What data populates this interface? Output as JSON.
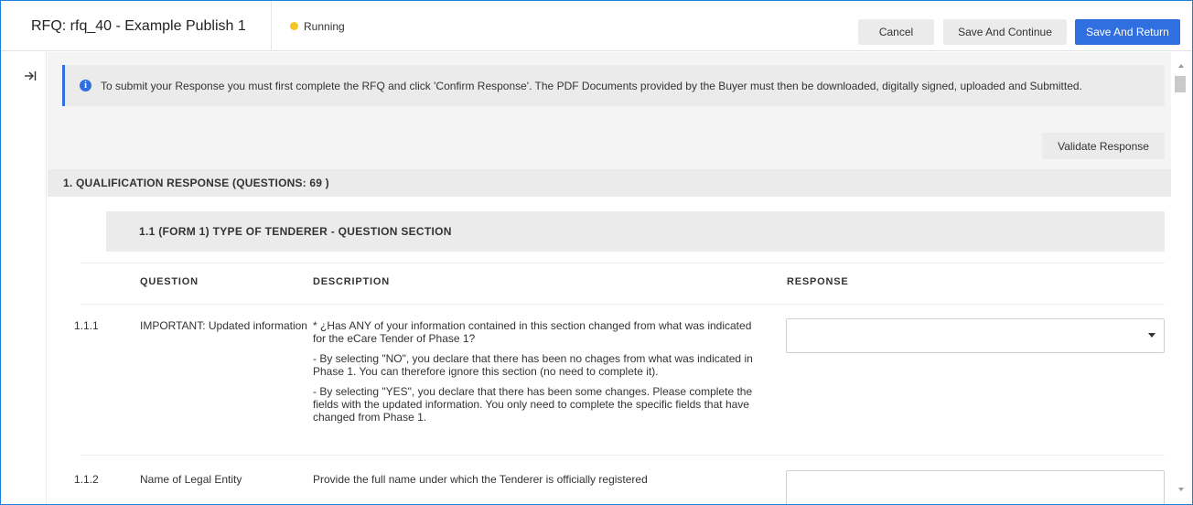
{
  "header": {
    "title": "RFQ: rfq_40 - Example Publish 1",
    "status": "Running",
    "status_color": "#f3c624",
    "cancel_label": "Cancel",
    "save_continue_label": "Save And Continue",
    "save_return_label": "Save And Return",
    "accent_color": "#2f6fe0"
  },
  "rail": {
    "collapse_icon": "collapse-right-icon"
  },
  "banner": {
    "icon": "info-icon",
    "text": "To submit your Response you must first complete the RFQ and click 'Confirm Response'. The PDF Documents provided by the Buyer must then be downloaded, digitally signed, uploaded and Submitted."
  },
  "validate_label": "Validate Response",
  "section": {
    "title": "1. QUALIFICATION RESPONSE (QUESTIONS: 69 )",
    "subsection": "1.1  (FORM 1) TYPE OF TENDERER - QUESTION SECTION",
    "columns": {
      "question": "QUESTION",
      "description": "DESCRIPTION",
      "response": "RESPONSE"
    },
    "rows": [
      {
        "number": "1.1.1",
        "question": "IMPORTANT: Updated information",
        "description": [
          "* ¿Has ANY of your information contained in this section changed from what was indicated for the eCare Tender of Phase 1?",
          "- By selecting \"NO\", you declare that there has been no chages from what was indicated in Phase 1. You can therefore ignore this section (no need to complete it).",
          "- By selecting \"YES\", you declare that there has been some changes. Please complete the fields with the updated information. You only need to complete the specific fields that have changed from Phase 1."
        ],
        "response_value": ""
      },
      {
        "number": "1.1.2",
        "question": "Name of Legal Entity",
        "description": [
          "Provide the full name under which the Tenderer is officially registered"
        ],
        "response_value": ""
      }
    ]
  }
}
